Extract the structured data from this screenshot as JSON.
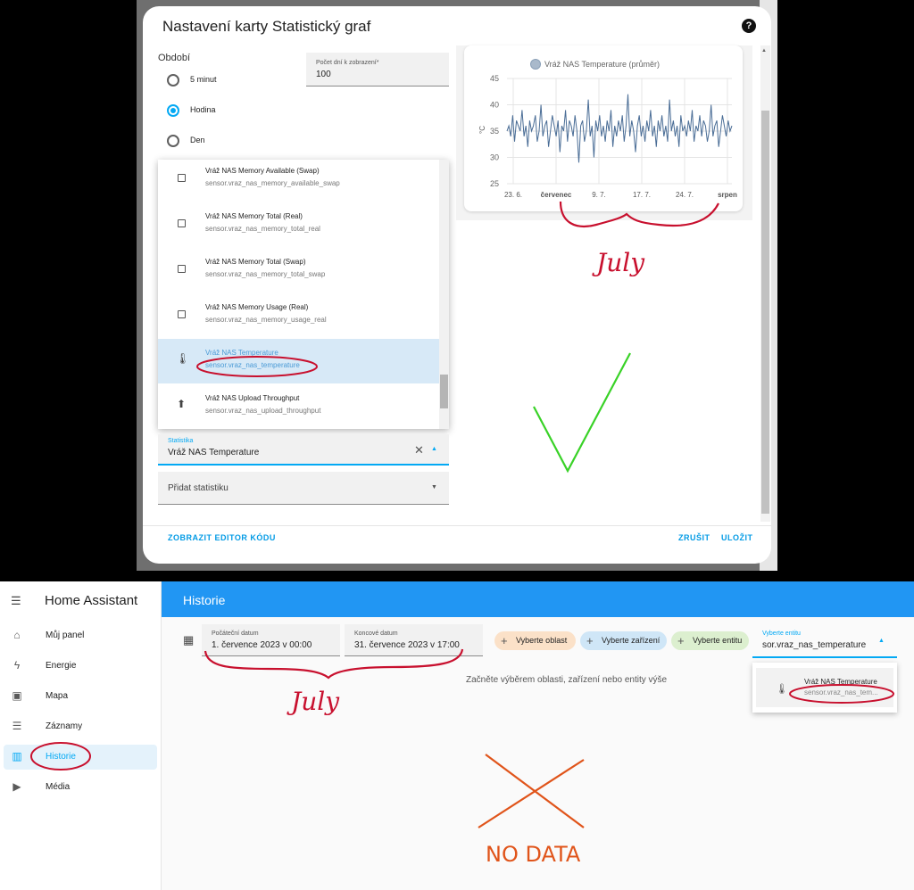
{
  "dialog": {
    "title": "Nastavení karty Statistický graf",
    "help_icon": "?",
    "period": {
      "label": "Období",
      "options": [
        "5 minut",
        "Hodina",
        "Den"
      ],
      "selected": "Hodina"
    },
    "days_field": {
      "label": "Počet dní k zobrazení*",
      "value": "100"
    },
    "entity_list": [
      {
        "icon": "chip-icon",
        "name": "Vráž NAS Memory Available (Swap)",
        "entity_id": "sensor.vraz_nas_memory_available_swap"
      },
      {
        "icon": "chip-icon",
        "name": "Vráž NAS Memory Total (Real)",
        "entity_id": "sensor.vraz_nas_memory_total_real"
      },
      {
        "icon": "chip-icon",
        "name": "Vráž NAS Memory Total (Swap)",
        "entity_id": "sensor.vraz_nas_memory_total_swap"
      },
      {
        "icon": "chip-icon",
        "name": "Vráž NAS Memory Usage (Real)",
        "entity_id": "sensor.vraz_nas_memory_usage_real"
      },
      {
        "icon": "thermometer-icon",
        "name": "Vráž NAS Temperature",
        "entity_id": "sensor.vraz_nas_temperature",
        "selected": true
      },
      {
        "icon": "upload-icon",
        "name": "Vráž NAS Upload Throughput",
        "entity_id": "sensor.vraz_nas_upload_throughput"
      }
    ],
    "statistic_field": {
      "label": "Statistika",
      "value": "Vráž NAS Temperature"
    },
    "add_statistic": "Přidat statistiku",
    "footer": {
      "code_editor": "ZOBRAZIT EDITOR KÓDU",
      "cancel": "ZRUŠIT",
      "save": "ULOŽIT"
    }
  },
  "chart_data": {
    "type": "line",
    "title": "",
    "series": [
      {
        "name": "Vráž NAS Temperature (průměr)",
        "color": "#4a6d96",
        "values": [
          35,
          36,
          34,
          38,
          33,
          37,
          36,
          35,
          39,
          34,
          36,
          32,
          37,
          35,
          36,
          38,
          33,
          35,
          40,
          34,
          36,
          37,
          32,
          35,
          38,
          36,
          34,
          37,
          31,
          36,
          35,
          39,
          33,
          37,
          36,
          34,
          38,
          35,
          29,
          36,
          37,
          33,
          35,
          41,
          34,
          36,
          30,
          37,
          35,
          38,
          34,
          36,
          33,
          37,
          35,
          39,
          32,
          36,
          34,
          37,
          35,
          38,
          33,
          36,
          42,
          34,
          37,
          35,
          31,
          36,
          38,
          34,
          36,
          33,
          37,
          35,
          39,
          34,
          36,
          32,
          37,
          35,
          38,
          34,
          36,
          33,
          41,
          35,
          37,
          34,
          36,
          32,
          38,
          35,
          36,
          34,
          37,
          35,
          39,
          33,
          36,
          35,
          38,
          34,
          37,
          36,
          33,
          35,
          40,
          34,
          36,
          37,
          32,
          35,
          38,
          36,
          34,
          37,
          35,
          36
        ]
      }
    ],
    "x_tick_labels": [
      "23. 6.",
      "červenec",
      "9. 7.",
      "17. 7.",
      "24. 7.",
      "srpen"
    ],
    "y_ticks": [
      45,
      40,
      35,
      30,
      25
    ],
    "ylabel": "°C",
    "ylim": [
      25,
      45
    ],
    "grid": true,
    "legend": "top"
  },
  "sidebar": {
    "menu_icon": "☰",
    "app_title": "Home Assistant",
    "items": [
      {
        "icon": "home-icon",
        "label": "Můj panel"
      },
      {
        "icon": "lightning-icon",
        "label": "Energie"
      },
      {
        "icon": "map-icon",
        "label": "Mapa"
      },
      {
        "icon": "list-icon",
        "label": "Záznamy"
      },
      {
        "icon": "chart-icon",
        "label": "Historie",
        "active": true
      },
      {
        "icon": "media-icon",
        "label": "Média"
      }
    ]
  },
  "history": {
    "title": "Historie",
    "start": {
      "label": "Počáteční datum",
      "value": "1. července 2023 v 00:00"
    },
    "end": {
      "label": "Koncové datum",
      "value": "31. července 2023 v 17:00"
    },
    "pills": [
      {
        "label": "Vyberte oblast",
        "color": "#fbe1c8"
      },
      {
        "label": "Vyberte zařízení",
        "color": "#cfe6f7"
      },
      {
        "label": "Vyberte entitu",
        "color": "#dcefcf"
      }
    ],
    "entity_select": {
      "label": "Vyberte entitu",
      "value": "sor.vraz_nas_temperature"
    },
    "entity_option": {
      "name": "Vráž NAS Temperature",
      "entity_id": "sensor.vraz_nas_tem..."
    },
    "hint": "Začněte výběrem oblasti, zařízení nebo entity výše"
  },
  "annotations": {
    "july_top": "July",
    "july_bottom": "July",
    "no_data": "NO DATA"
  }
}
